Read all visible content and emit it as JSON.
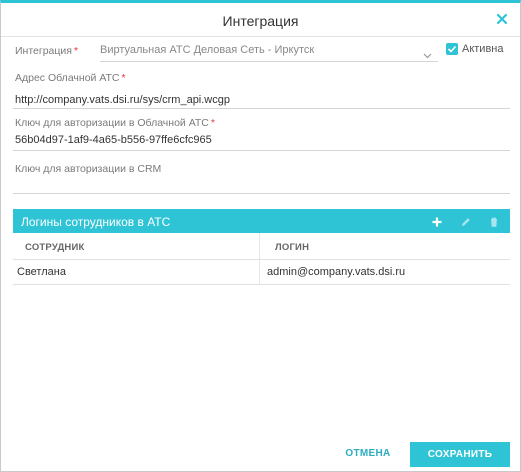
{
  "dialog": {
    "title": "Интеграция"
  },
  "integration": {
    "label": "Интеграция",
    "selected_value": "Виртуальная АТС Деловая Сеть - Иркутск",
    "active_label": "Активна",
    "active_checked": true
  },
  "cloud_address": {
    "label": "Адрес Облачной АТС",
    "value": "http://company.vats.dsi.ru/sys/crm_api.wcgp"
  },
  "cloud_key": {
    "label": "Ключ для авторизации в Облачной АТС",
    "value": "56b04d97-1af9-4a65-b556-97ffe6cfc965"
  },
  "crm_key": {
    "label": "Ключ для авторизации в CRM",
    "value": ""
  },
  "required_mark": "*",
  "logins_panel": {
    "title": "Логины сотрудников в АТС",
    "columns": [
      "СОТРУДНИК",
      "ЛОГИН"
    ],
    "rows": [
      [
        "Светлана",
        "admin@company.vats.dsi.ru"
      ]
    ]
  },
  "footer": {
    "cancel_label": "ОТМЕНА",
    "save_label": "СОХРАНИТЬ"
  },
  "colors": {
    "accent": "#2ec4d6",
    "required": "#e53935"
  }
}
